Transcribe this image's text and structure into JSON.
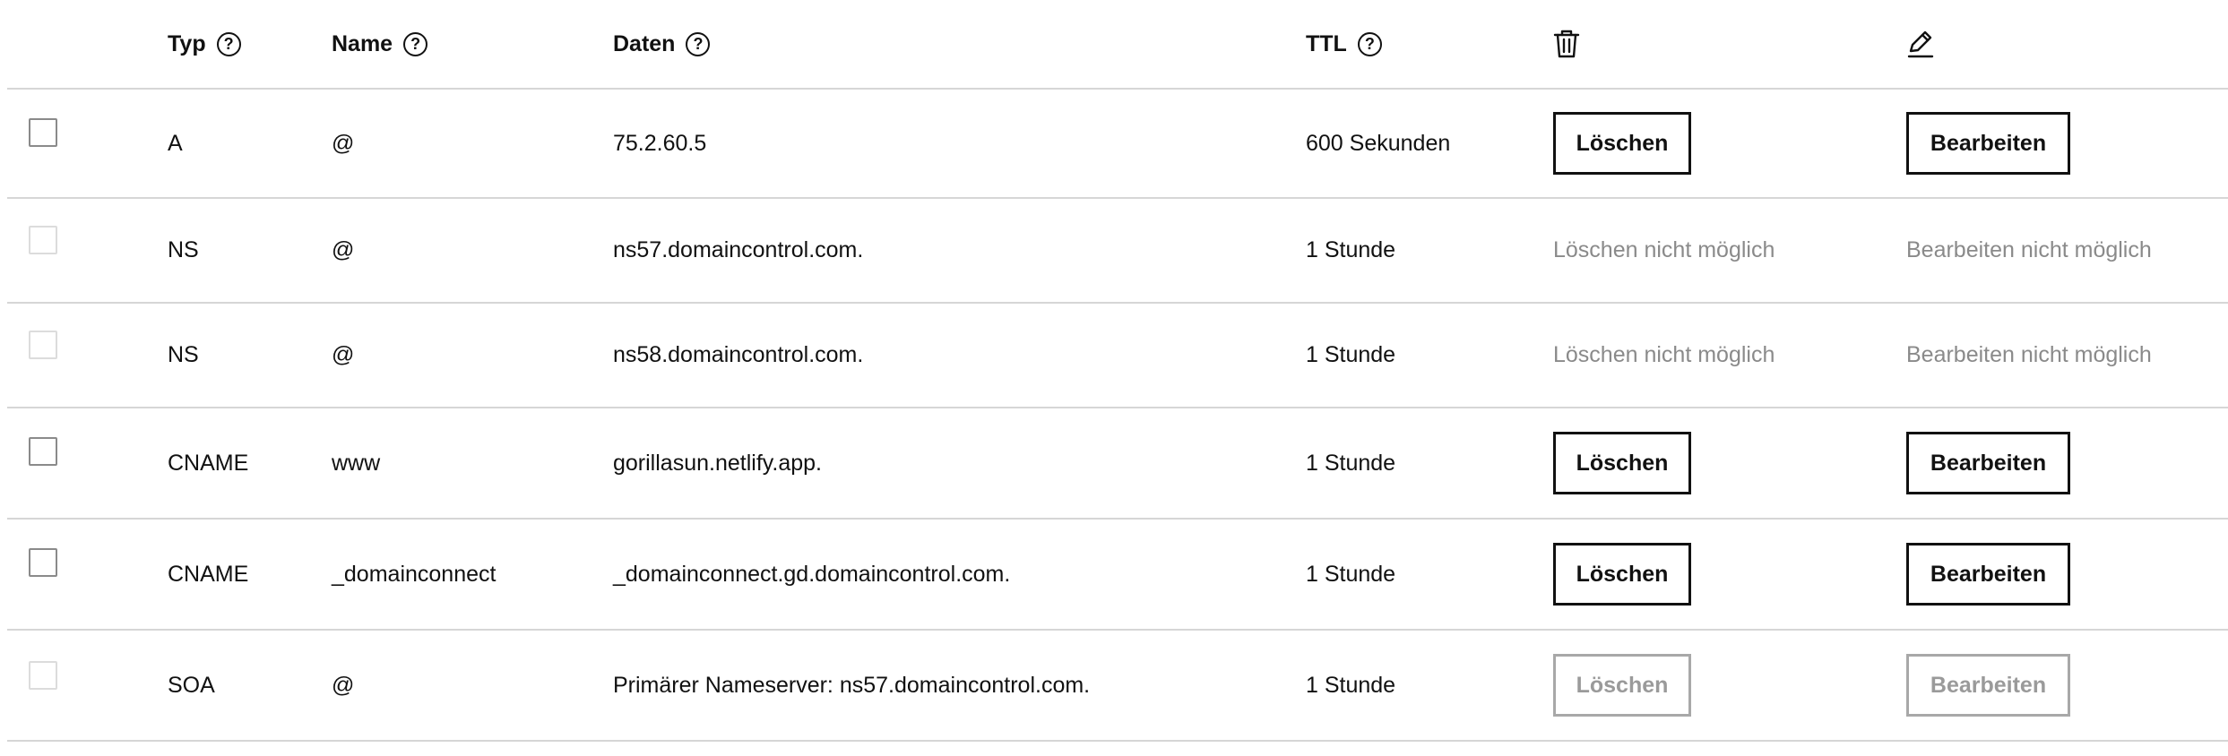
{
  "header": {
    "typ": "Typ",
    "name": "Name",
    "daten": "Daten",
    "ttl": "TTL",
    "help_glyph": "?",
    "delete_icon": "trash-icon",
    "edit_icon": "pencil-icon"
  },
  "rows": [
    {
      "typ": "A",
      "name": "@",
      "daten": "75.2.60.5",
      "ttl": "600 Sekunden",
      "delete": "Löschen",
      "edit": "Bearbeiten"
    },
    {
      "typ": "NS",
      "name": "@",
      "daten": "ns57.domaincontrol.com.",
      "ttl": "1 Stunde",
      "delete": "Löschen nicht möglich",
      "edit": "Bearbeiten nicht möglich"
    },
    {
      "typ": "NS",
      "name": "@",
      "daten": "ns58.domaincontrol.com.",
      "ttl": "1 Stunde",
      "delete": "Löschen nicht möglich",
      "edit": "Bearbeiten nicht möglich"
    },
    {
      "typ": "CNAME",
      "name": "www",
      "daten": "gorillasun.netlify.app.",
      "ttl": "1 Stunde",
      "delete": "Löschen",
      "edit": "Bearbeiten"
    },
    {
      "typ": "CNAME",
      "name": "_domainconnect",
      "daten": "_domainconnect.gd.domaincontrol.com.",
      "ttl": "1 Stunde",
      "delete": "Löschen",
      "edit": "Bearbeiten"
    },
    {
      "typ": "SOA",
      "name": "@",
      "daten": "Primärer Nameserver: ns57.domaincontrol.com.",
      "ttl": "1 Stunde",
      "delete": "Löschen",
      "edit": "Bearbeiten"
    }
  ]
}
